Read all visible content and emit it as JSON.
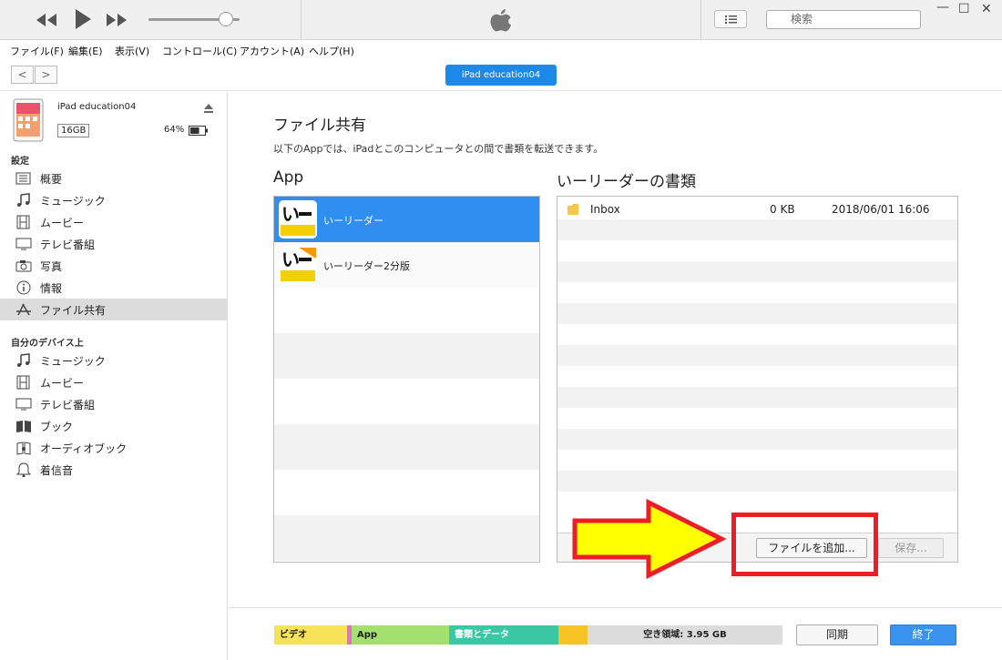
{
  "player": {
    "rewind_icon": "rewind-icon",
    "play_icon": "play-icon",
    "forward_icon": "fast-forward-icon",
    "volume_fraction": 0.85
  },
  "search": {
    "placeholder": "検索"
  },
  "menu": [
    "ファイル(F)",
    "編集(E)",
    "表示(V)",
    "コントロール(C)",
    "アカウント(A)",
    "ヘルプ(H)"
  ],
  "device": {
    "pill_label": "iPad education04",
    "name": "iPad education04",
    "capacity": "16GB",
    "battery": "64%"
  },
  "sidebar": {
    "settings_header": "設定",
    "settings_items": [
      {
        "label": "概要",
        "icon": "summary-list-icon"
      },
      {
        "label": "ミュージック",
        "icon": "music-note-icon"
      },
      {
        "label": "ムービー",
        "icon": "film-icon"
      },
      {
        "label": "テレビ番組",
        "icon": "tv-icon"
      },
      {
        "label": "写真",
        "icon": "camera-icon"
      },
      {
        "label": "情報",
        "icon": "info-icon"
      },
      {
        "label": "ファイル共有",
        "icon": "app-store-icon"
      }
    ],
    "ondevice_header": "自分のデバイス上",
    "ondevice_items": [
      {
        "label": "ミュージック",
        "icon": "music-note-icon"
      },
      {
        "label": "ムービー",
        "icon": "film-icon"
      },
      {
        "label": "テレビ番組",
        "icon": "tv-icon"
      },
      {
        "label": "ブック",
        "icon": "book-icon"
      },
      {
        "label": "オーディオブック",
        "icon": "audiobook-icon"
      },
      {
        "label": "着信音",
        "icon": "bell-icon"
      }
    ]
  },
  "main": {
    "title": "ファイル共有",
    "description": "以下のAppでは、iPadとこのコンピュータとの間で書類を転送できます。",
    "apps_header": "App",
    "apps": [
      {
        "name": "いーリーダー",
        "selected": true
      },
      {
        "name": "いーリーダー2分版",
        "selected": false
      }
    ],
    "docs_header": "いーリーダーの書類",
    "docs": [
      {
        "name": "Inbox",
        "size": "0 KB",
        "date": "2018/06/01 16:06"
      }
    ],
    "add_file_button": "ファイルを追加...",
    "save_button": "保存..."
  },
  "capacity_bar": {
    "segments": [
      {
        "label": "ビデオ",
        "color": "#f7e35a"
      },
      {
        "label": "",
        "color": "#e46fd2"
      },
      {
        "label": "App",
        "color": "#a3e06d"
      },
      {
        "label": "書類とデータ",
        "color": "#39c7a4"
      },
      {
        "label": "",
        "color": "#f7c325"
      },
      {
        "label": "空き領域: 3.95 GB",
        "color": "#dcdcdc"
      }
    ]
  },
  "footer": {
    "sync_button": "同期",
    "done_button": "終了"
  },
  "colors": {
    "accent": "#1c89e8",
    "selection": "#2f8ff0",
    "annotation_red": "#ee1c24",
    "annotation_yellow": "#ffff00"
  }
}
